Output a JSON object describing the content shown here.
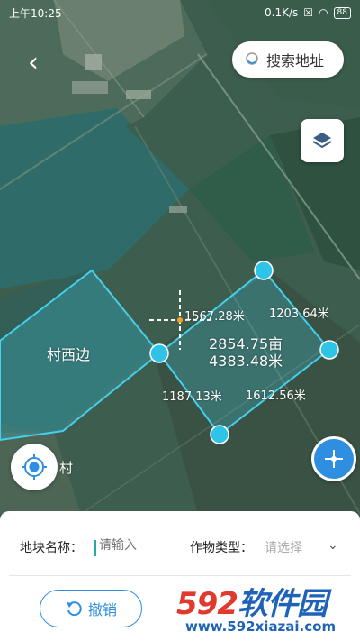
{
  "status_bar": {
    "time": "上午10:25",
    "speed": "0.1K/s",
    "battery": "88"
  },
  "search": {
    "label": "搜索地址"
  },
  "map": {
    "field_name": "村西边",
    "area_mu": "2854.75亩",
    "perimeter": "4383.48米",
    "segments": [
      "1567.28米",
      "1203.64米",
      "1187.13米",
      "1612.56米"
    ],
    "village_label": "村"
  },
  "form": {
    "plot_name_label": "地块名称：",
    "plot_name_placeholder": "请输入",
    "crop_type_label": "作物类型：",
    "crop_type_placeholder": "请选择"
  },
  "actions": {
    "undo_label": "撤销"
  },
  "watermark": {
    "brand_digits": "592",
    "brand_text": "软件园",
    "url": "www.592xiazai.com"
  }
}
